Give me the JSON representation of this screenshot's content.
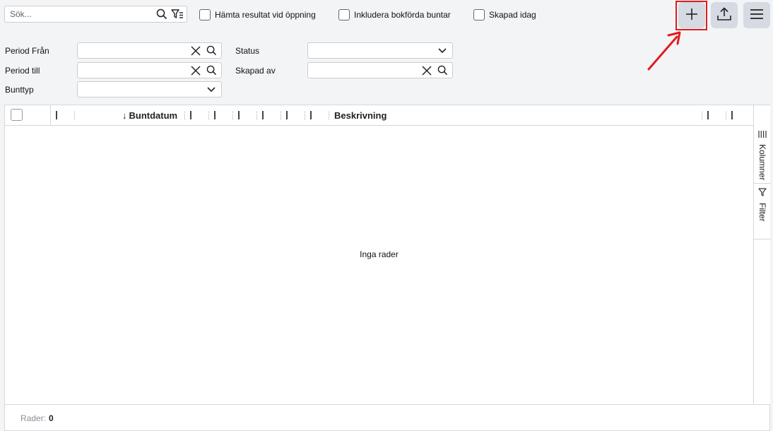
{
  "search": {
    "placeholder": "Sök..."
  },
  "options": {
    "fetch_on_open": "Hämta resultat vid öppning",
    "include_posted": "Inkludera bokförda buntar",
    "created_today": "Skapad idag"
  },
  "filters": {
    "period_from": "Period Från",
    "period_to": "Period till",
    "batch_type": "Bunttyp",
    "status": "Status",
    "created_by": "Skapad av"
  },
  "grid": {
    "columns": {
      "batch_date": "Buntdatum",
      "description": "Beskrivning",
      "sort_arrow": "↓"
    },
    "empty_message": "Inga rader",
    "side_tabs": {
      "columns": "Kolumner",
      "filter": "Filter"
    },
    "footer": {
      "rows_label": "Rader:",
      "rows_count": "0"
    }
  },
  "colors": {
    "highlight": "#e11d1d",
    "button_bg": "#d6dae2"
  }
}
